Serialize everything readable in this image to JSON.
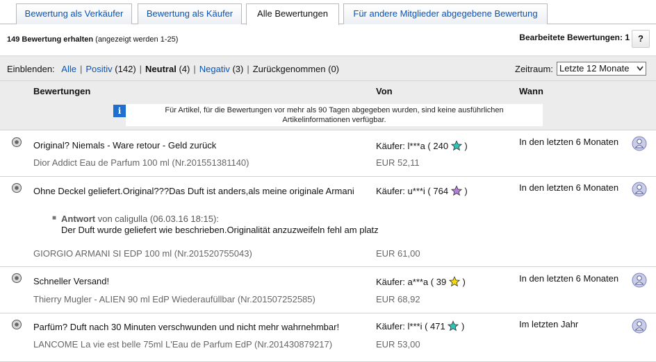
{
  "tabs": [
    {
      "label": "Bewertung als Verkäufer",
      "active": false
    },
    {
      "label": "Bewertung als Käufer",
      "active": false
    },
    {
      "label": "Alle Bewertungen",
      "active": true
    },
    {
      "label": "Für andere Mitglieder abgegebene Bewertung",
      "active": false
    }
  ],
  "summary": {
    "count": "149 Bewertung erhalten",
    "shown": "(angezeigt werden 1-25)",
    "edited": "Bearbeitete Bewertungen: 1",
    "help": "?"
  },
  "filters": {
    "label": "Einblenden:",
    "all": "Alle",
    "positive": "Positiv",
    "positive_count": "(142)",
    "neutral": "Neutral",
    "neutral_count": "(4)",
    "negative": "Negativ",
    "negative_count": "(3)",
    "withdrawn": "Zurückgenommen (0)",
    "separator": "|",
    "period_label": "Zeitraum:",
    "period_value": "Letzte 12 Monate"
  },
  "columns": {
    "ratings": "Bewertungen",
    "from": "Von",
    "when": "Wann"
  },
  "info": {
    "icon": "i",
    "line1": "Für Artikel, für die Bewertungen vor mehr als 90 Tagen abgegeben wurden, sind keine ausführlichen",
    "line2": "Artikelinformationen verfügbar."
  },
  "entries": [
    {
      "comment": "Original? Niemals - Ware retour - Geld zurück",
      "item": "Dior Addict Eau de Parfum 100 ml (Nr.201551381140)",
      "buyer": "Käufer: l***a ( 240",
      "buyer_close": ")",
      "star_color": "#2ec4b6",
      "price": "EUR 52,11",
      "when": "In den letzten 6 Monaten",
      "rating_icon": "neutral-circle-icon"
    },
    {
      "comment": "Ohne Deckel geliefert.Original???Das Duft ist anders,als meine originale Armani",
      "item": "GIORGIO ARMANI SI EDP 100 ml (Nr.201520755043)",
      "buyer": "Käufer: u***i ( 764",
      "buyer_close": ")",
      "star_color": "#b57edc",
      "price": "EUR 61,00",
      "when": "In den letzten 6 Monaten",
      "rating_icon": "neutral-circle-icon",
      "reply": {
        "label": "Antwort",
        "by": "von caligulla (06.03.16 18:15):",
        "text": "Der Duft wurde geliefert wie beschrieben.Originalität anzuzweifeln fehl am platz"
      }
    },
    {
      "comment": "Schneller Versand!",
      "item": "Thierry Mugler - ALIEN 90 ml EdP Wiederaufüllbar (Nr.201507252585)",
      "buyer": "Käufer: a***a ( 39",
      "buyer_close": ")",
      "star_color": "#f5d90a",
      "price": "EUR 68,92",
      "when": "In den letzten 6 Monaten",
      "rating_icon": "neutral-circle-icon"
    },
    {
      "comment": "Parfüm? Duft nach 30 Minuten verschwunden und nicht mehr wahrnehmbar!",
      "item": "LANCOME La vie est belle 75ml L'Eau de Parfum EdP (Nr.201430879217)",
      "buyer": "Käufer: l***i ( 471",
      "buyer_close": ")",
      "star_color": "#2ec4b6",
      "price": "EUR 53,00",
      "when": "Im letzten Jahr",
      "rating_icon": "neutral-circle-icon"
    }
  ]
}
